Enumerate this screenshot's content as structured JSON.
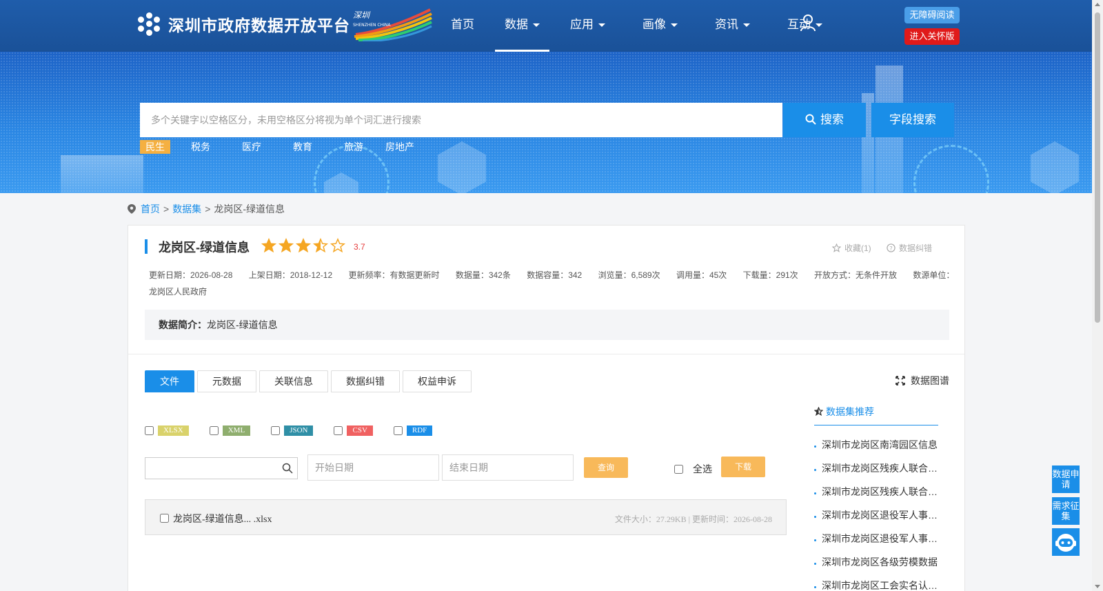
{
  "header": {
    "site_title": "深圳市政府数据开放平台",
    "nav": [
      {
        "label": "首页",
        "dropdown": false
      },
      {
        "label": "数据",
        "dropdown": true
      },
      {
        "label": "应用",
        "dropdown": true
      },
      {
        "label": "画像",
        "dropdown": true
      },
      {
        "label": "资讯",
        "dropdown": true
      },
      {
        "label": "互动",
        "dropdown": true
      }
    ],
    "accessibility_btn": "无障碍阅读",
    "care_btn": "进入关怀版"
  },
  "search": {
    "placeholder": "多个关键字以空格区分，未用空格区分将视为单个词汇进行搜索",
    "search_btn": "搜索",
    "field_search_btn": "字段搜索",
    "tags": [
      "民生",
      "税务",
      "医疗",
      "教育",
      "旅游",
      "房地产"
    ]
  },
  "breadcrumb": {
    "home": "首页",
    "sep1": ">",
    "datasets": "数据集",
    "sep2": ">",
    "current": "龙岗区-绿道信息"
  },
  "dataset": {
    "title": "龙岗区-绿道信息",
    "rating": "3.7",
    "rating_value": 3.7,
    "favorite": "收藏(1)",
    "error_report": "数据纠错",
    "meta": [
      "更新日期：2026-08-28",
      "上架日期：2018-12-12",
      "更新频率：有数据更新时",
      "数据量：342条",
      "数据容量：342",
      "浏览量：6,589次",
      "调用量：45次",
      "下载量：291次",
      "开放方式：无条件开放",
      "数源单位：龙岗区人民政府"
    ],
    "intro_label": "数据简介：",
    "intro_text": "龙岗区-绿道信息"
  },
  "tabs": [
    "文件",
    "元数据",
    "关联信息",
    "数据纠错",
    "权益申诉"
  ],
  "graph_link": "数据图谱",
  "formats": [
    {
      "label": "XLSX",
      "color": "#d9d26b"
    },
    {
      "label": "XML",
      "color": "#8fae6e"
    },
    {
      "label": "JSON",
      "color": "#2f8fa6"
    },
    {
      "label": "CSV",
      "color": "#f06161"
    },
    {
      "label": "RDF",
      "color": "#1a8ee8"
    }
  ],
  "filters": {
    "start_date": "开始日期",
    "end_date": "结束日期",
    "query_btn": "查询",
    "select_all": "全选",
    "download_btn": "下载"
  },
  "file": {
    "name": "龙岗区-绿道信息... .xlsx",
    "info": "文件大小：27.29KB | 更新时间：2026-08-28"
  },
  "recommend": {
    "title": "数据集推荐",
    "items": [
      "深圳市龙岗区南湾园区信息",
      "深圳市龙岗区残疾人联合会信息",
      "深圳市龙岗区残疾人联合会数据",
      "深圳市龙岗区退役军人事务局信息",
      "深圳市龙岗区退役军人事务数据",
      "深圳市龙岗区各级劳模数据",
      "深圳市龙岗区工会实名认证信息"
    ]
  },
  "float": {
    "apply": "数据申请",
    "collect": "需求征集"
  },
  "colors": {
    "primary": "#1a8ee8",
    "header": "#1e5aa8",
    "accent_orange": "#f8b95a",
    "care_red": "#e01a1a"
  }
}
